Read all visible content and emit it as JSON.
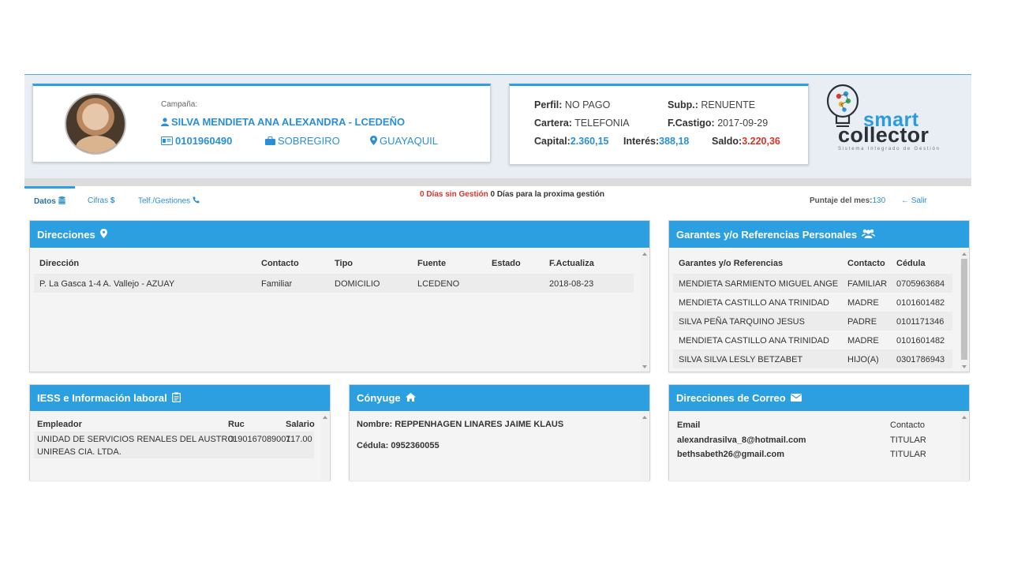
{
  "profile": {
    "campaign_label": "Campaña:",
    "name": "SILVA MENDIETA ANA ALEXANDRA - LCEDEÑO",
    "id_number": "0101960490",
    "product": "SOBREGIRO",
    "city": "GUAYAQUIL",
    "icons": {
      "name": "user-icon",
      "id": "id-card-icon",
      "product": "briefcase-icon",
      "city": "map-marker-icon"
    }
  },
  "debt": {
    "perfil_label": "Perfil:",
    "perfil": "NO PAGO",
    "subp_label": "Subp.:",
    "subp": "RENUENTE",
    "cartera_label": "Cartera:",
    "cartera": "TELEFONIA",
    "castigo_label": "F.Castigo:",
    "castigo": "2017-09-29",
    "capital_label": "Capital:",
    "capital": "2.360,15",
    "interes_label": "Interés:",
    "interes": "388,18",
    "saldo_label": "Saldo:",
    "saldo": "3.220,36"
  },
  "logo": {
    "word1": "smart",
    "word2": "collector",
    "tagline": "Sistema Integrado de Gestión"
  },
  "tabs": [
    {
      "label": "Datos",
      "icon": "database-icon"
    },
    {
      "label": "Cifras",
      "icon": "dollar-icon"
    },
    {
      "label": "Telf./Gestiones",
      "icon": "phone-icon"
    }
  ],
  "notice": {
    "days_without": "0 Días sin Gestión",
    "days_next": "0 Días para la proxima gestión"
  },
  "score": {
    "label": "Puntaje del mes:",
    "value": "130"
  },
  "exit_label": "Salir",
  "colors": {
    "accent": "#2b9fe0",
    "link": "#2a8fd6",
    "alert": "#d9342b"
  },
  "direcciones": {
    "title": "Direcciones",
    "icon": "map-marker-icon",
    "headers": [
      "Dirección",
      "Contacto",
      "Tipo",
      "Fuente",
      "Estado",
      "F.Actualiza"
    ],
    "rows": [
      [
        "P. La Gasca 1-4 A. Vallejo - AZUAY",
        "Familiar",
        "DOMICILIO",
        "LCEDENO",
        "",
        "2018-08-23"
      ]
    ]
  },
  "garantes": {
    "title": "Garantes y/o Referencias Personales",
    "icon": "users-icon",
    "headers": [
      "Garantes y/o Referencias",
      "Contacto",
      "Cédula"
    ],
    "rows": [
      [
        "MENDIETA SARMIENTO MIGUEL ANGE",
        "FAMILIAR",
        "0705963684"
      ],
      [
        "MENDIETA CASTILLO ANA TRINIDAD",
        "MADRE",
        "0101601482"
      ],
      [
        "SILVA PEÑA TARQUINO JESUS",
        "PADRE",
        "0101171346"
      ],
      [
        "MENDIETA CASTILLO ANA TRINIDAD",
        "MADRE",
        "0101601482"
      ],
      [
        "SILVA SILVA LESLY BETZABET",
        "HIJO(A)",
        "0301786943"
      ]
    ]
  },
  "iess": {
    "title": "IESS e Información laboral",
    "icon": "clipboard-icon",
    "headers": [
      "Empleador",
      "Ruc",
      "Salario"
    ],
    "rows": [
      [
        "UNIDAD DE SERVICIOS RENALES DEL AUSTRO",
        "UNIREAS CIA. LTDA.",
        "0190167089001",
        "717.00"
      ]
    ]
  },
  "conyuge": {
    "title": "Cónyuge",
    "icon": "home-icon",
    "name_label": "Nombre:",
    "name": "REPPENHAGEN LINARES JAIME KLAUS",
    "cedula_label": "Cédula:",
    "cedula": "0952360055"
  },
  "correo": {
    "title": "Direcciones de Correo",
    "icon": "envelope-icon",
    "headers": [
      "Email",
      "Contacto"
    ],
    "rows": [
      [
        "alexandrasilva_8@hotmail.com",
        "TITULAR"
      ],
      [
        "bethsabeth26@gmail.com",
        "TITULAR"
      ]
    ]
  }
}
